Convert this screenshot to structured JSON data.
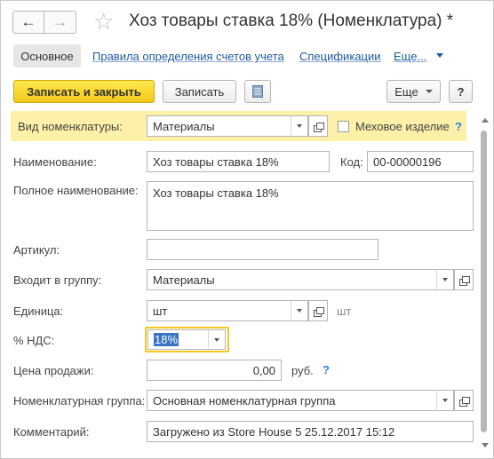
{
  "header": {
    "title": "Хоз товары ставка 18% (Номенклатура) *",
    "more_dots": "⋮",
    "close": "×"
  },
  "tabs": {
    "main": "Основное",
    "accounts_rules": "Правила определения счетов учета",
    "specifications": "Спецификации",
    "more": "Еще..."
  },
  "toolbar": {
    "save_close": "Записать и закрыть",
    "save": "Записать",
    "more": "Еще",
    "help": "?"
  },
  "form": {
    "kind_label": "Вид номенклатуры:",
    "kind_value": "Материалы",
    "fur_label": "Меховое изделие",
    "fur_help": "?",
    "name_label": "Наименование:",
    "name_value": "Хоз товары ставка 18%",
    "code_label": "Код:",
    "code_value": "00-00000196",
    "fullname_label": "Полное наименование:",
    "fullname_value": "Хоз товары ставка 18%",
    "article_label": "Артикул:",
    "article_value": "",
    "group_label": "Входит в группу:",
    "group_value": "Материалы",
    "unit_label": "Единица:",
    "unit_value": "шт",
    "unit_hint": "шт",
    "vat_label": "% НДС:",
    "vat_value": "18%",
    "price_label": "Цена продажи:",
    "price_value": "0,00",
    "price_unit": "руб.",
    "price_help": "?",
    "nomgroup_label": "Номенклатурная группа:",
    "nomgroup_value": "Основная номенклатурная группа",
    "comment_label": "Комментарий:",
    "comment_value": "Загружено из Store House 5 25.12.2017 15:12"
  },
  "colors": {
    "accent_yellow": "#f2c81a",
    "highlight_row": "#fdf0a8",
    "link_blue": "#1f5aa0",
    "help_blue": "#2f7fd3",
    "selection": "#3a75c4"
  }
}
